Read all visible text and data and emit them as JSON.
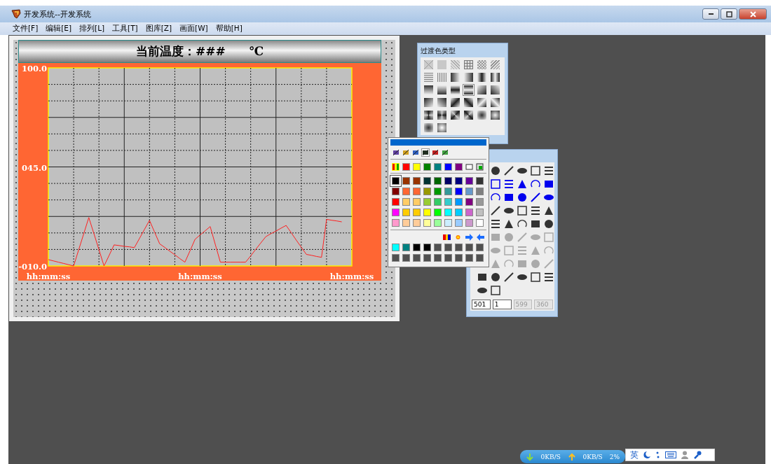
{
  "window": {
    "title": "开发系统--开发系统"
  },
  "menu": [
    "文件[F]",
    "编辑[E]",
    "排列[L]",
    "工具[T]",
    "图库[Z]",
    "画面[W]",
    "帮助[H]"
  ],
  "canvas": {
    "header": "当前温度：###　　℃",
    "chart_data": {
      "type": "line",
      "grid": true,
      "ylim": [
        -10,
        100
      ],
      "yticks": [
        {
          "value": 100,
          "label": "100.0"
        },
        {
          "value": 45,
          "label": "045.0"
        },
        {
          "value": -10,
          "label": "-010.0"
        }
      ],
      "categories": [
        "hh:mm:ss",
        null,
        null,
        null,
        null,
        null,
        null,
        null,
        null,
        null,
        null,
        null,
        null,
        null,
        null,
        null,
        null,
        null,
        null,
        null,
        null,
        null,
        null,
        null,
        null,
        null,
        null,
        null,
        null,
        null,
        "hh:mm:ss",
        null,
        null,
        null,
        null,
        null,
        null,
        null,
        null,
        null,
        null,
        null,
        null,
        null,
        null,
        null,
        null,
        null,
        null,
        null,
        null,
        null,
        null,
        null,
        null,
        null,
        null,
        null,
        null,
        null,
        "hh:mm:ss"
      ],
      "series": [
        {
          "color": "#ff2020",
          "values": [
            -6.5,
            -7.2,
            -7.9,
            -8.6,
            -9.3,
            -10,
            -1.0,
            7.9,
            16.9,
            7.9,
            -1.0,
            -10,
            -4.2,
            1.7,
            1.3,
            0.9,
            0.6,
            0.2,
            5.2,
            10.3,
            15.3,
            8.8,
            2.3,
            0.3,
            -1.8,
            -3.8,
            -5.9,
            -7.9,
            -1.6,
            4.8,
            7.2,
            9.5,
            11.9,
            2.0,
            -7.9,
            -7.9,
            -7.9,
            -7.9,
            -7.9,
            -7.9,
            -4.4,
            -0.8,
            2.8,
            6.3,
            7.9,
            9.4,
            11.0,
            12.5,
            8.5,
            4.4,
            0.4,
            -3.6,
            -4.1,
            -4.7,
            -5.2,
            15.9,
            15.4,
            15.0,
            14.5,
            null,
            null
          ]
        }
      ]
    }
  },
  "gradient_panel": {
    "title": "过渡色类型",
    "swatches": [
      {
        "selected": false
      },
      {
        "selected": false
      },
      {
        "selected": false
      },
      {
        "selected": false
      },
      {
        "selected": false
      },
      {
        "selected": false
      },
      {
        "selected": false
      },
      {
        "selected": false
      },
      {
        "selected": false
      },
      {
        "selected": false
      },
      {
        "selected": false
      },
      {
        "selected": false
      },
      {
        "selected": false
      },
      {
        "selected": false
      },
      {
        "selected": false
      },
      {
        "selected": true
      },
      {
        "selected": false
      },
      {
        "selected": false
      },
      {
        "selected": false
      },
      {
        "selected": false
      },
      {
        "selected": false
      },
      {
        "selected": false
      },
      {
        "selected": false
      },
      {
        "selected": false
      },
      {
        "selected": false
      },
      {
        "selected": false
      },
      {
        "selected": false
      },
      {
        "selected": false
      },
      {
        "selected": false
      },
      {
        "selected": false
      },
      {
        "selected": false
      },
      {
        "selected": false
      }
    ]
  },
  "color_panel": {
    "tabs": [
      {
        "selected": false
      },
      {
        "selected": false
      },
      {
        "selected": false
      },
      {
        "selected": true
      },
      {
        "selected": false
      },
      {
        "selected": false
      }
    ],
    "basic_colors": [
      {
        "color": "#ff0000"
      },
      {
        "color": "#ffff00"
      },
      {
        "color": "#008000"
      },
      {
        "color": "#008080"
      },
      {
        "color": "#0000ff"
      },
      {
        "color": "#800080"
      }
    ],
    "colors": [
      {
        "color": "#000000",
        "selected": true
      },
      {
        "color": "#993300",
        "selected": false
      },
      {
        "color": "#993300",
        "selected": false
      },
      {
        "color": "#003333",
        "selected": false
      },
      {
        "color": "#006600",
        "selected": false
      },
      {
        "color": "#000066",
        "selected": false
      },
      {
        "color": "#000080",
        "selected": false
      },
      {
        "color": "#660099",
        "selected": false
      },
      {
        "color": "#333333",
        "selected": false
      },
      {
        "color": "#800000",
        "selected": false
      },
      {
        "color": "#ff6633",
        "selected": false
      },
      {
        "color": "#ff6633",
        "selected": false
      },
      {
        "color": "#999900",
        "selected": false
      },
      {
        "color": "#009900",
        "selected": false
      },
      {
        "color": "#339999",
        "selected": false
      },
      {
        "color": "#0000ff",
        "selected": false
      },
      {
        "color": "#6699cc",
        "selected": false
      },
      {
        "color": "#808080",
        "selected": false
      },
      {
        "color": "#ff0000",
        "selected": false
      },
      {
        "color": "#ffcc66",
        "selected": false
      },
      {
        "color": "#ffcc66",
        "selected": false
      },
      {
        "color": "#99cc33",
        "selected": false
      },
      {
        "color": "#33cc66",
        "selected": false
      },
      {
        "color": "#33cccc",
        "selected": false
      },
      {
        "color": "#0099ff",
        "selected": false
      },
      {
        "color": "#800080",
        "selected": false
      },
      {
        "color": "#999999",
        "selected": false
      },
      {
        "color": "#ff00ff",
        "selected": false
      },
      {
        "color": "#ffcc00",
        "selected": false
      },
      {
        "color": "#ffcc00",
        "selected": false
      },
      {
        "color": "#ffff00",
        "selected": false
      },
      {
        "color": "#00ff00",
        "selected": false
      },
      {
        "color": "#00ffff",
        "selected": false
      },
      {
        "color": "#00ccff",
        "selected": false
      },
      {
        "color": "#cc66cc",
        "selected": false
      },
      {
        "color": "#c0c0c0",
        "selected": false
      },
      {
        "color": "#ff99cc",
        "selected": false
      },
      {
        "color": "#ffcc99",
        "selected": false
      },
      {
        "color": "#ffcc99",
        "selected": false
      },
      {
        "color": "#ffff99",
        "selected": false
      },
      {
        "color": "#99ff99",
        "selected": false
      },
      {
        "color": "#cceeff",
        "selected": false
      },
      {
        "color": "#99ccff",
        "selected": false
      },
      {
        "color": "#cc99cc",
        "selected": false
      },
      {
        "color": "#ffffff",
        "selected": false
      }
    ],
    "custom_colors": [
      {
        "color": "#00ffff"
      },
      {
        "color": "#008080"
      },
      {
        "color": "#000000"
      },
      {
        "color": "#000000"
      },
      {
        "color": "#505050"
      },
      {
        "color": "#505050"
      },
      {
        "color": "#505050"
      },
      {
        "color": "#505050"
      },
      {
        "color": "#505050"
      },
      {
        "color": "#505050"
      },
      {
        "color": "#505050"
      },
      {
        "color": "#505050"
      },
      {
        "color": "#505050"
      },
      {
        "color": "#505050"
      },
      {
        "color": "#505050"
      },
      {
        "color": "#505050"
      },
      {
        "color": "#505050"
      },
      {
        "color": "#505050"
      }
    ]
  },
  "toolbox": {
    "fields": [
      {
        "value": "501",
        "disabled": false
      },
      {
        "value": "1",
        "disabled": false
      },
      {
        "value": "599",
        "disabled": true
      },
      {
        "value": "360",
        "disabled": true
      }
    ]
  },
  "net_meter": {
    "down": "0KB/S",
    "up": "0KB/S",
    "cpu": "2%"
  },
  "ime_bar": {
    "mode": "英"
  }
}
